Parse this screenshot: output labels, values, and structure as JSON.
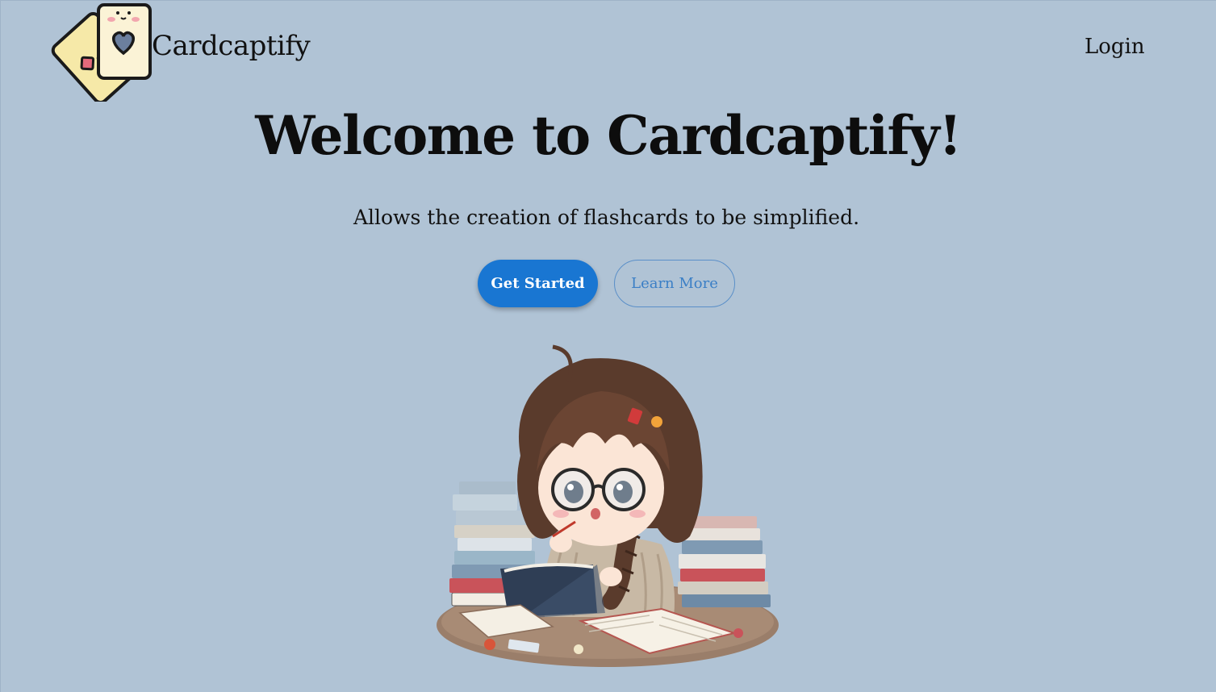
{
  "header": {
    "brand": "Cardcaptify",
    "login_label": "Login"
  },
  "hero": {
    "title": "Welcome to Cardcaptify!",
    "subtitle": "Allows the creation of flashcards to be simplified.",
    "primary_button_label": "Get Started",
    "secondary_button_label": "Learn More"
  },
  "colors": {
    "background": "#b0c3d5",
    "primary": "#1976d2",
    "secondary_text": "#3b7fc6",
    "text": "#111111"
  },
  "icons": {
    "logo": "playing-cards-icon",
    "illustration": "studying-girl-illustration"
  }
}
